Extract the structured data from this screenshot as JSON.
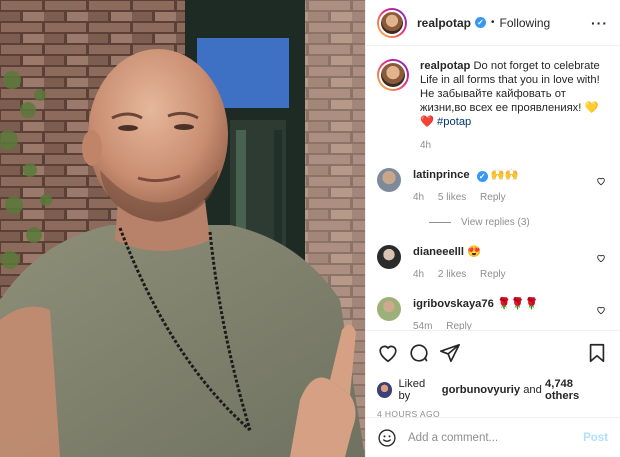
{
  "header": {
    "username": "realpotap",
    "verified_mark": "✓",
    "separator": "•",
    "follow_status": "Following",
    "more_icon": "more-horizontal-icon"
  },
  "caption": {
    "username": "realpotap",
    "text_en": " Do not forget to celebrate Life in all forms that you in love with!",
    "text_ru": "Не забывайте кайфовать от жизни,во всех ее проявлениях! ",
    "emoji": "💛❤️",
    "hashtag": "#potap",
    "time": "4h"
  },
  "comments": [
    {
      "username": "latinprince",
      "text": "🙌🙌",
      "time": "4h",
      "likes": "5 likes",
      "reply": "Reply",
      "view_replies": "View replies (3)"
    },
    {
      "username": "dianeeelll",
      "text": "😍",
      "time": "4h",
      "likes": "2 likes",
      "reply": "Reply"
    },
    {
      "username": "igribovskaya76",
      "text": "🌹🌹🌹",
      "time": "54m",
      "reply": "Reply"
    }
  ],
  "liked_by": {
    "prefix": "Liked by ",
    "user": "gorbunovyuriy",
    "middle": " and ",
    "count": "4,748 others"
  },
  "post_time": "4 HOURS AGO",
  "add_comment": {
    "placeholder": "Add a comment...",
    "post_label": "Post"
  },
  "colors": {
    "link": "#00376b",
    "verified": "#3897f0",
    "muted": "#8e8e8e",
    "post_disabled": "#b2dffc"
  }
}
